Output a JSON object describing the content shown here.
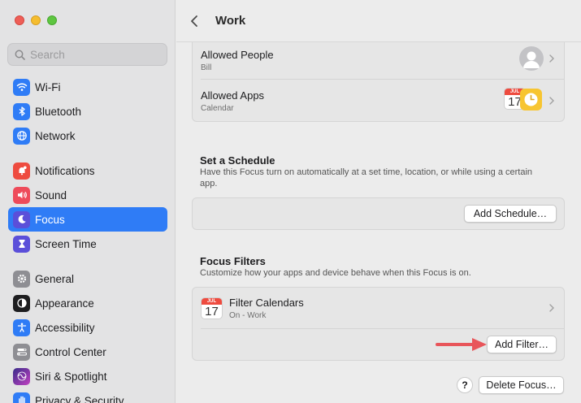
{
  "window": {
    "traffic_colors": [
      "#ee5e57",
      "#f5bd2f",
      "#5ec640"
    ]
  },
  "search": {
    "placeholder": "Search"
  },
  "sidebar": {
    "items": [
      {
        "label": "Wi-Fi",
        "icon": "wifi-icon",
        "color": "#2f7cf6"
      },
      {
        "label": "Bluetooth",
        "icon": "bluetooth-icon",
        "color": "#2f7cf6"
      },
      {
        "label": "Network",
        "icon": "globe-icon",
        "color": "#2f7cf6"
      },
      {
        "label": "Notifications",
        "icon": "bell-icon",
        "color": "#ee4b3f"
      },
      {
        "label": "Sound",
        "icon": "speaker-icon",
        "color": "#ee4b5a"
      },
      {
        "label": "Focus",
        "icon": "moon-icon",
        "color": "#5b4fd9",
        "active": true
      },
      {
        "label": "Screen Time",
        "icon": "hourglass-icon",
        "color": "#5b4fd9"
      },
      {
        "label": "General",
        "icon": "gear-icon",
        "color": "#8e8e93"
      },
      {
        "label": "Appearance",
        "icon": "appearance-icon",
        "color": "#1d1d1f"
      },
      {
        "label": "Accessibility",
        "icon": "accessibility-icon",
        "color": "#2f7cf6"
      },
      {
        "label": "Control Center",
        "icon": "control-center-icon",
        "color": "#8e8e93"
      },
      {
        "label": "Siri & Spotlight",
        "icon": "siri-icon",
        "color": "#7a5af8"
      },
      {
        "label": "Privacy & Security",
        "icon": "hand-icon",
        "color": "#2f7cf6"
      }
    ]
  },
  "header": {
    "title": "Work"
  },
  "allowed": {
    "people_title": "Allowed People",
    "people_sub": "Bill",
    "apps_title": "Allowed Apps",
    "apps_sub": "Calendar",
    "cal_month": "JUL",
    "cal_day": "17"
  },
  "schedule": {
    "title": "Set a Schedule",
    "desc": "Have this Focus turn on automatically at a set time, location, or while using a certain app.",
    "button": "Add Schedule…"
  },
  "filters": {
    "title": "Focus Filters",
    "desc": "Customize how your apps and device behave when this Focus is on.",
    "item_title": "Filter Calendars",
    "item_sub": "On - Work",
    "cal_month": "JUL",
    "cal_day": "17",
    "add_button": "Add Filter…",
    "arrow_color": "#e8555a"
  },
  "footer": {
    "help": "?",
    "delete_button": "Delete Focus…"
  }
}
